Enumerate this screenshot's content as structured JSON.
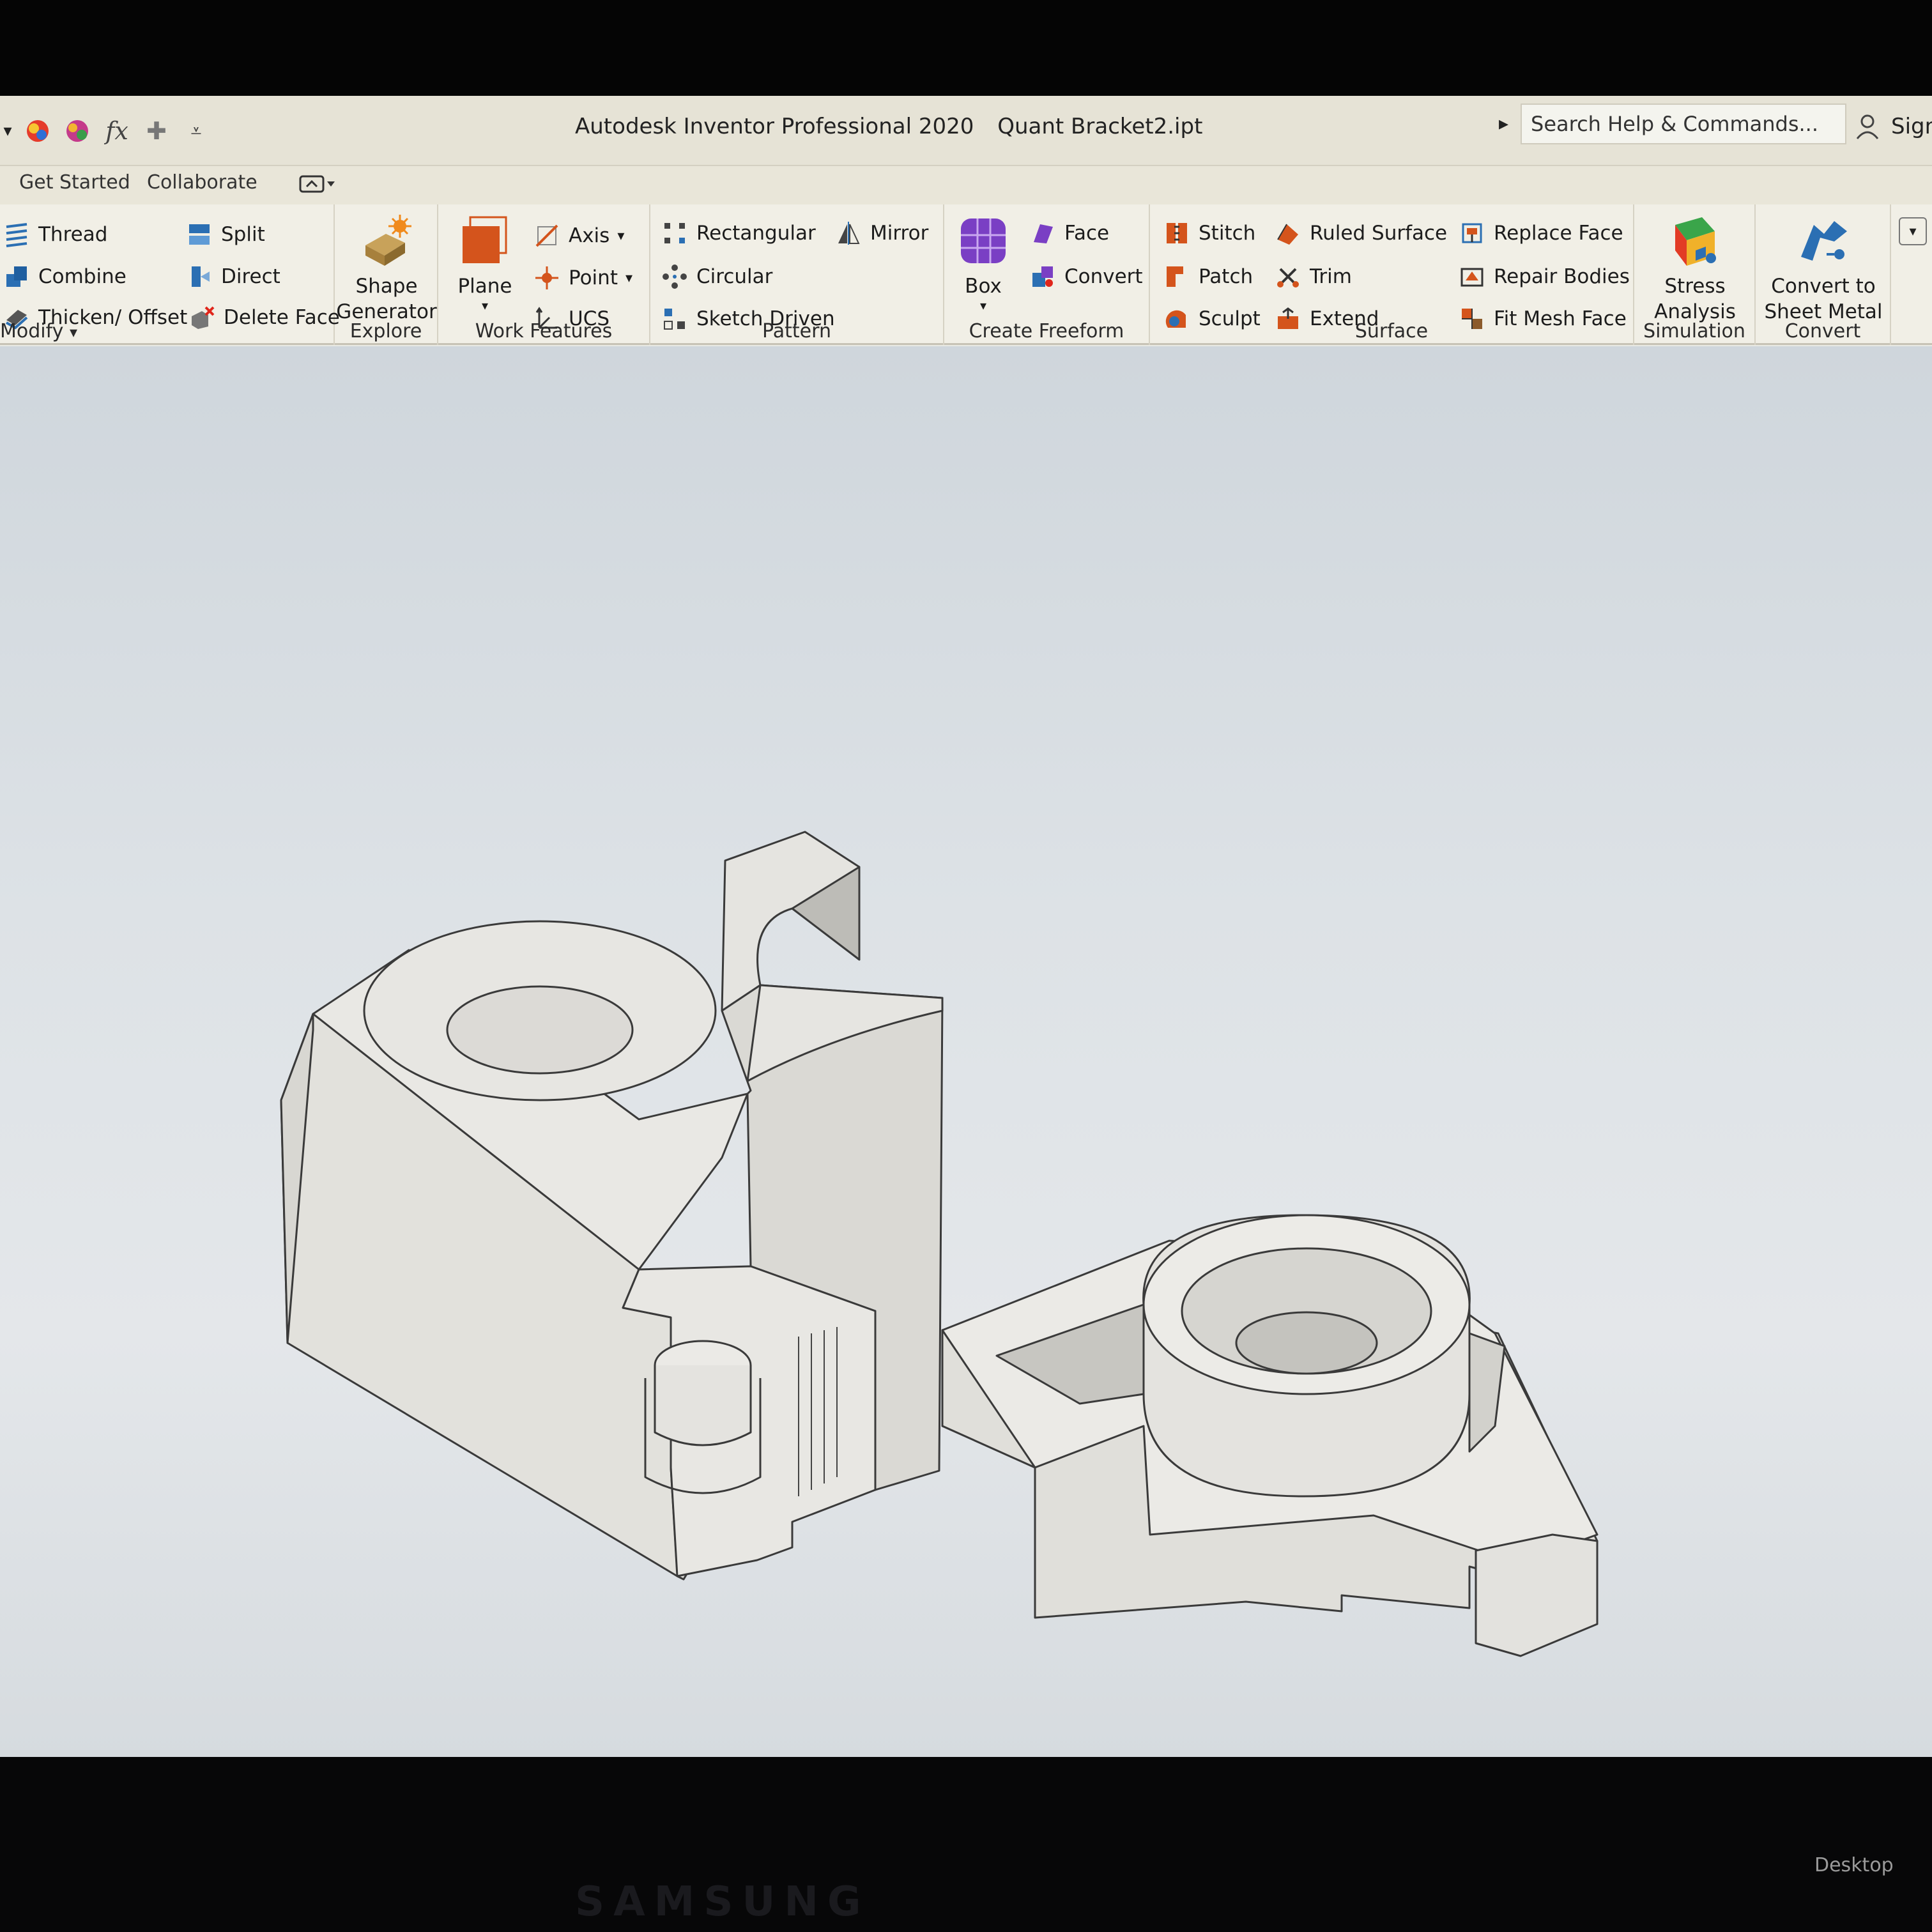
{
  "window": {
    "app_name": "Autodesk Inventor Professional 2020",
    "document": "Quant Bracket2.ipt",
    "search_placeholder": "Search Help & Commands...",
    "sign_in": "Sign"
  },
  "qat_icons": [
    "dropdown-icon",
    "appearance-icon",
    "material-icon",
    "fx-icon",
    "plus-icon",
    "customize-icon"
  ],
  "tabs": {
    "get_started": "Get Started",
    "collaborate": "Collaborate"
  },
  "ribbon": {
    "modify": {
      "label": "Modify",
      "thread": "Thread",
      "split": "Split",
      "combine": "Combine",
      "direct": "Direct",
      "thicken": "Thicken/ Offset",
      "delete_face": "Delete Face"
    },
    "explore": {
      "label": "Explore",
      "shape": "Shape",
      "generator": "Generator"
    },
    "work_features": {
      "label": "Work Features",
      "plane": "Plane",
      "axis": "Axis",
      "point": "Point",
      "ucs": "UCS"
    },
    "pattern": {
      "label": "Pattern",
      "rectangular": "Rectangular",
      "mirror": "Mirror",
      "circular": "Circular",
      "sketch_driven": "Sketch Driven"
    },
    "freeform": {
      "label": "Create Freeform",
      "box": "Box",
      "face": "Face",
      "convert": "Convert"
    },
    "surface": {
      "label": "Surface",
      "stitch": "Stitch",
      "ruled_surface": "Ruled Surface",
      "replace_face": "Replace Face",
      "patch": "Patch",
      "trim": "Trim",
      "repair_bodies": "Repair Bodies",
      "sculpt": "Sculpt",
      "extend": "Extend",
      "fit_mesh_face": "Fit Mesh Face"
    },
    "simulation": {
      "label": "Simulation",
      "stress": "Stress",
      "analysis": "Analysis"
    },
    "convert": {
      "label": "Convert",
      "convert_to": "Convert to",
      "sheet_metal": "Sheet Metal"
    }
  },
  "colors": {
    "accent_orange": "#d4541c",
    "accent_purple": "#7a3fc4",
    "accent_blue": "#2b6fb3",
    "model_face": "#e8e6e2"
  },
  "monitor": {
    "brand": "SAMSUNG",
    "taskbar_label": "Desktop"
  }
}
